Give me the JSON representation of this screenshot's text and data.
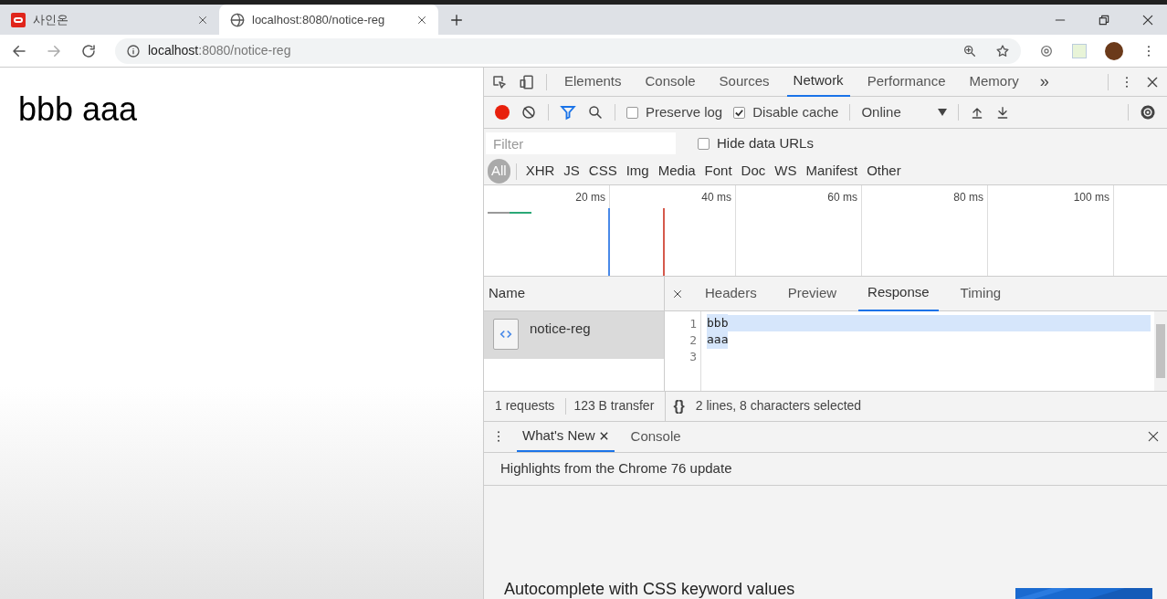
{
  "browser": {
    "tabs": [
      {
        "title": "사인온",
        "selected": false,
        "kind": "site"
      },
      {
        "title": "localhost:8080/notice-reg",
        "selected": true,
        "kind": "globe"
      }
    ],
    "address": {
      "host": "localhost",
      "rest": ":8080/notice-reg"
    }
  },
  "page": {
    "text": "bbb aaa"
  },
  "devtools": {
    "tabs": [
      {
        "label": "Elements",
        "selected": false
      },
      {
        "label": "Console",
        "selected": false
      },
      {
        "label": "Sources",
        "selected": false
      },
      {
        "label": "Network",
        "selected": true
      },
      {
        "label": "Performance",
        "selected": false
      },
      {
        "label": "Memory",
        "selected": false
      }
    ],
    "more": "»",
    "toolbar": {
      "recording": true,
      "options": [
        {
          "label": "Preserve log",
          "checked": false
        },
        {
          "label": "Disable cache",
          "checked": true
        }
      ],
      "throttle": "Online"
    },
    "filter": {
      "placeholder": "Filter",
      "hide_data_urls": {
        "label": "Hide data URLs",
        "checked": false
      }
    },
    "types": [
      {
        "label": "All",
        "selected": true
      },
      {
        "label": "XHR",
        "selected": false
      },
      {
        "label": "JS",
        "selected": false
      },
      {
        "label": "CSS",
        "selected": false
      },
      {
        "label": "Img",
        "selected": false
      },
      {
        "label": "Media",
        "selected": false
      },
      {
        "label": "Font",
        "selected": false
      },
      {
        "label": "Doc",
        "selected": false
      },
      {
        "label": "WS",
        "selected": false
      },
      {
        "label": "Manifest",
        "selected": false
      },
      {
        "label": "Other",
        "selected": false
      }
    ],
    "timeline": {
      "ticks": [
        "20 ms",
        "40 ms",
        "60 ms",
        "80 ms",
        "100 ms"
      ]
    },
    "name_header": "Name",
    "requests": [
      {
        "name": "notice-reg",
        "selected": true
      }
    ],
    "detail_tabs": [
      {
        "label": "Headers",
        "selected": false
      },
      {
        "label": "Preview",
        "selected": false
      },
      {
        "label": "Response",
        "selected": true
      },
      {
        "label": "Timing",
        "selected": false
      }
    ],
    "response_lines": [
      {
        "number": "1",
        "text": "bbb",
        "selected": true
      },
      {
        "number": "2",
        "text": "aaa",
        "selected": true
      },
      {
        "number": "3",
        "selected": false
      }
    ],
    "status": {
      "requests": "1 requests",
      "transfer": "123 B transfer",
      "braces": "{}",
      "selection": "2 lines, 8 characters selected"
    },
    "drawer": {
      "tabs": [
        {
          "label": "What's New",
          "selected": true,
          "closable": true
        },
        {
          "label": "Console",
          "selected": false,
          "closable": false
        }
      ],
      "headline": "Highlights from the Chrome 76 update",
      "item": "Autocomplete with CSS keyword values"
    }
  }
}
